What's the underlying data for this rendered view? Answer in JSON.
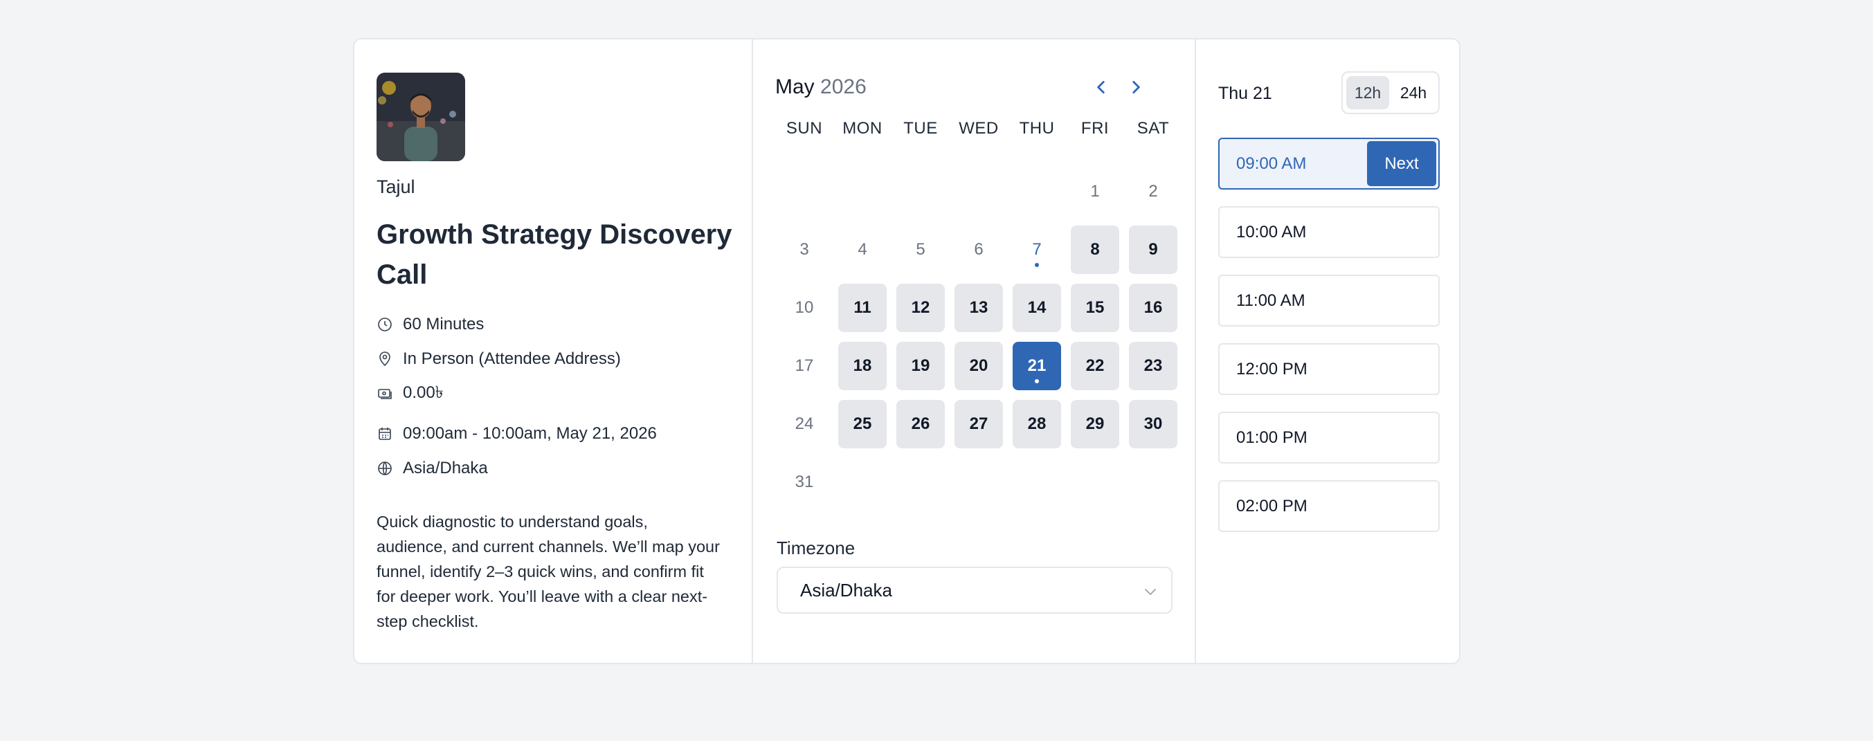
{
  "host": {
    "name": "Tajul",
    "avatar_alt": "Tajul"
  },
  "event": {
    "title": "Growth Strategy Discovery Call",
    "duration": "60 Minutes",
    "location": "In Person (Attendee Address)",
    "price": "0.00৳",
    "datetime": "09:00am - 10:00am, May 21, 2026",
    "timezone": "Asia/Dhaka",
    "description": "Quick diagnostic to understand goals, audience, and current channels. We’ll map your funnel, identify 2–3 quick wins, and confirm fit for deeper work. You’ll leave with a clear next-step checklist."
  },
  "calendar": {
    "month": "May",
    "year": "2026",
    "weekdays": [
      "SUN",
      "MON",
      "TUE",
      "WED",
      "THU",
      "FRI",
      "SAT"
    ],
    "leading_blanks": 5,
    "days": [
      {
        "n": "1",
        "state": "disabled"
      },
      {
        "n": "2",
        "state": "disabled"
      },
      {
        "n": "3",
        "state": "disabled"
      },
      {
        "n": "4",
        "state": "disabled"
      },
      {
        "n": "5",
        "state": "disabled"
      },
      {
        "n": "6",
        "state": "disabled"
      },
      {
        "n": "7",
        "state": "today"
      },
      {
        "n": "8",
        "state": "available"
      },
      {
        "n": "9",
        "state": "available"
      },
      {
        "n": "10",
        "state": "disabled"
      },
      {
        "n": "11",
        "state": "available"
      },
      {
        "n": "12",
        "state": "available"
      },
      {
        "n": "13",
        "state": "available"
      },
      {
        "n": "14",
        "state": "available"
      },
      {
        "n": "15",
        "state": "available"
      },
      {
        "n": "16",
        "state": "available"
      },
      {
        "n": "17",
        "state": "disabled"
      },
      {
        "n": "18",
        "state": "available"
      },
      {
        "n": "19",
        "state": "available"
      },
      {
        "n": "20",
        "state": "available"
      },
      {
        "n": "21",
        "state": "selected"
      },
      {
        "n": "22",
        "state": "available"
      },
      {
        "n": "23",
        "state": "available"
      },
      {
        "n": "24",
        "state": "disabled"
      },
      {
        "n": "25",
        "state": "available"
      },
      {
        "n": "26",
        "state": "available"
      },
      {
        "n": "27",
        "state": "available"
      },
      {
        "n": "28",
        "state": "available"
      },
      {
        "n": "29",
        "state": "available"
      },
      {
        "n": "30",
        "state": "available"
      },
      {
        "n": "31",
        "state": "disabled"
      }
    ]
  },
  "timezone_picker": {
    "label": "Timezone",
    "value": "Asia/Dhaka"
  },
  "slots_panel": {
    "date_label": "Thu 21",
    "format_options": [
      "12h",
      "24h"
    ],
    "active_format": "12h",
    "next_label": "Next",
    "slots": [
      {
        "time": "09:00 AM",
        "selected": true
      },
      {
        "time": "10:00 AM",
        "selected": false
      },
      {
        "time": "11:00 AM",
        "selected": false
      },
      {
        "time": "12:00 PM",
        "selected": false
      },
      {
        "time": "01:00 PM",
        "selected": false
      },
      {
        "time": "02:00 PM",
        "selected": false
      }
    ]
  },
  "colors": {
    "accent": "#2f67b5",
    "available_bg": "#e5e7eb",
    "page_bg": "#f3f4f6"
  }
}
